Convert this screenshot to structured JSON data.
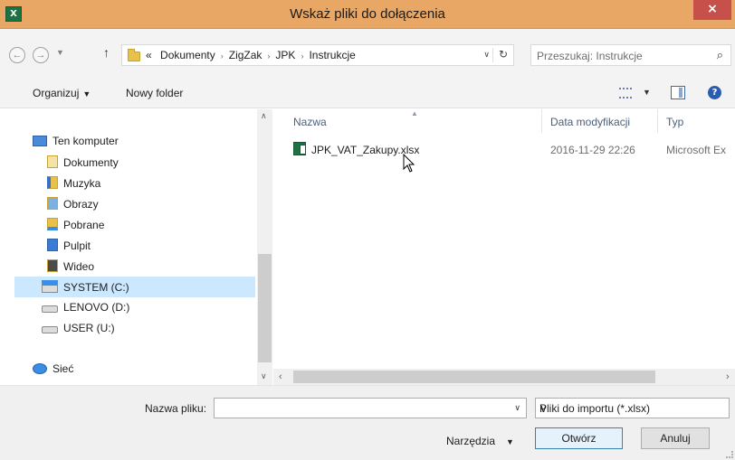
{
  "window": {
    "title": "Wskaż pliki do dołączenia",
    "app_icon": "X",
    "close_glyph": "×"
  },
  "address": {
    "prefix": "«",
    "crumbs": [
      "Dokumenty",
      "ZigZak",
      "JPK",
      "Instrukcje"
    ],
    "separator": "›"
  },
  "search": {
    "placeholder": "Przeszukaj: Instrukcje"
  },
  "toolbar": {
    "organize_label": "Organizuj",
    "new_folder_label": "Nowy folder"
  },
  "nav": {
    "items": [
      {
        "label": "Ten komputer",
        "icon": "computer-icon"
      },
      {
        "label": "Dokumenty",
        "icon": "documents-folder-icon"
      },
      {
        "label": "Muzyka",
        "icon": "music-folder-icon"
      },
      {
        "label": "Obrazy",
        "icon": "pictures-folder-icon"
      },
      {
        "label": "Pobrane",
        "icon": "downloads-folder-icon"
      },
      {
        "label": "Pulpit",
        "icon": "desktop-folder-icon"
      },
      {
        "label": "Wideo",
        "icon": "video-folder-icon"
      },
      {
        "label": "SYSTEM (C:)",
        "icon": "system-drive-icon"
      },
      {
        "label": "LENOVO (D:)",
        "icon": "drive-icon"
      },
      {
        "label": "USER (U:)",
        "icon": "drive-icon"
      },
      {
        "label": "Sieć",
        "icon": "network-icon"
      }
    ],
    "selected_index": 7
  },
  "columns": {
    "name": "Nazwa",
    "modified": "Data modyfikacji",
    "type": "Typ"
  },
  "files": [
    {
      "name": "JPK_VAT_Zakupy.xlsx",
      "modified": "2016-11-29 22:26",
      "type": "Microsoft Ex"
    }
  ],
  "bottom": {
    "filename_label": "Nazwa pliku:",
    "filename_value": "",
    "filetype_value": "Pliki do importu (*.xlsx)",
    "tools_label": "Narzędzia",
    "open_label": "Otwórz",
    "cancel_label": "Anuluj"
  },
  "colors": {
    "titlebar": "#e8a765",
    "close": "#c7504b",
    "selection": "#cce8ff",
    "primary_border": "#3c7fb1"
  }
}
